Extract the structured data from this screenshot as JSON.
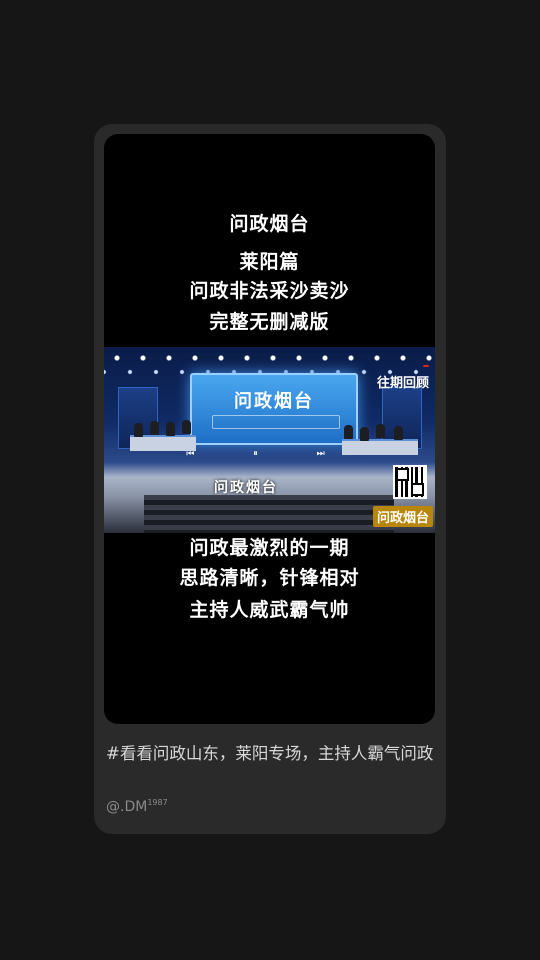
{
  "post": {
    "overlay_top": [
      "问政烟台",
      "莱阳篇",
      "问政非法采沙卖沙",
      "完整无删减版"
    ],
    "overlay_bottom": [
      "问政最激烈的一期",
      "思路清晰，针锋相对",
      "主持人威武霸气帅"
    ],
    "stage": {
      "screen_title": "问政烟台",
      "floor_label": "问政烟台",
      "logo_badge": "",
      "logo_text": "往期回顾",
      "corner_logo": "问政烟台",
      "controls": "⏮ ⏸ ⏭"
    },
    "description": "#看看问政山东，莱阳专场，主持人霸气问政",
    "author_name": "@.DM",
    "author_suffix": "1987"
  },
  "colors": {
    "page_bg": "#161616",
    "card_bg": "#2a2a2a",
    "video_bg": "#000000"
  }
}
